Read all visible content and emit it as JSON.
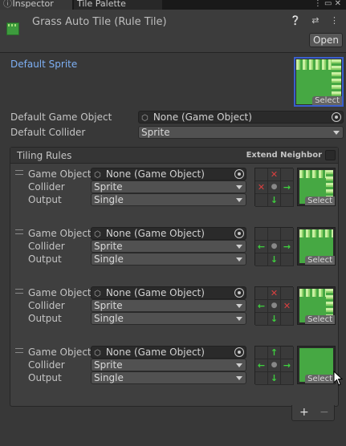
{
  "tabs": [
    {
      "label": "Inspector",
      "icon": "info-icon"
    },
    {
      "label": "Tile Palette",
      "icon": ""
    }
  ],
  "tab_actions": "⋮ ▭ ✕",
  "header": {
    "title": "Grass Auto Tile (Rule Tile)",
    "icons": "❔ ⇄ ⋮",
    "open_label": "Open"
  },
  "default_sprite": {
    "label": "Default Sprite",
    "select_label": "Select"
  },
  "default_game_object": {
    "label": "Default Game Object",
    "value": "None (Game Object)"
  },
  "default_collider": {
    "label": "Default Collider",
    "value": "Sprite"
  },
  "tiling_rules": {
    "title": "Tiling Rules",
    "extend_neighbor_label": "Extend Neighbor",
    "labels": {
      "game_object": "Game Object",
      "collider": "Collider",
      "output": "Output"
    },
    "rules": [
      {
        "game_object": "None (Game Object)",
        "collider": "Sprite",
        "output": "Single",
        "neighbors": [
          "",
          "x",
          "",
          "x",
          "o",
          "a",
          "",
          "a",
          ""
        ],
        "sprite": {
          "edges": [
            "top",
            "right"
          ],
          "select_label": "Select"
        }
      },
      {
        "game_object": "None (Game Object)",
        "collider": "Sprite",
        "output": "Single",
        "neighbors": [
          "",
          "",
          "",
          "a",
          "o",
          "a",
          "",
          "a",
          ""
        ],
        "sprite": {
          "edges": [
            "top"
          ],
          "select_label": "Select"
        }
      },
      {
        "game_object": "None (Game Object)",
        "collider": "Sprite",
        "output": "Single",
        "neighbors": [
          "",
          "x",
          "",
          "a",
          "o",
          "x",
          "",
          "a",
          ""
        ],
        "sprite": {
          "edges": [
            "top",
            "right"
          ],
          "select_label": "Select"
        }
      },
      {
        "game_object": "None (Game Object)",
        "collider": "Sprite",
        "output": "Single",
        "neighbors": [
          "",
          "a",
          "",
          "a",
          "o",
          "a",
          "",
          "a",
          ""
        ],
        "sprite": {
          "edges": [
            "corner"
          ],
          "select_label": "Select"
        }
      }
    ],
    "add_label": "+",
    "remove_label": "−"
  },
  "colors": {
    "background": "#383838",
    "accent_link": "#7eb0f5",
    "selection_border": "#3a5fcd",
    "neighbor_this": "#3fcf3f",
    "neighbor_not": "#d94040",
    "grass": "#46a843"
  }
}
